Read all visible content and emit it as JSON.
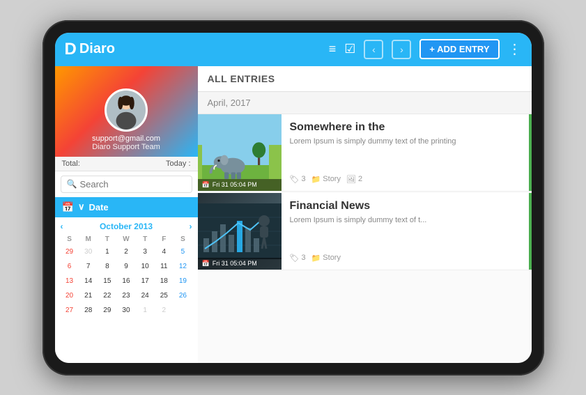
{
  "app": {
    "name": "Diaro",
    "logo_letter": "D"
  },
  "toolbar": {
    "add_entry_label": "+ ADD ENTRY",
    "nav_back": "‹",
    "nav_forward": "›"
  },
  "sidebar": {
    "email": "support@gmail.com",
    "team": "Diaro Support Team",
    "stats": {
      "total_label": "Total:",
      "today_label": "Today :"
    },
    "search_placeholder": "Search",
    "date_filter_label": "Date"
  },
  "calendar": {
    "month": "October 2013",
    "day_headers": [
      "S",
      "M",
      "T",
      "W",
      "T",
      "F",
      "S"
    ],
    "today_day": 1,
    "weeks": [
      [
        "29",
        "30",
        "1",
        "2",
        "3",
        "4",
        "5"
      ],
      [
        "6",
        "7",
        "8",
        "9",
        "10",
        "11",
        "12"
      ],
      [
        "13",
        "14",
        "15",
        "16",
        "17",
        "18",
        "19"
      ],
      [
        "20",
        "21",
        "22",
        "23",
        "24",
        "25",
        "26"
      ],
      [
        "27",
        "28",
        "29",
        "30",
        "1",
        "2",
        ""
      ]
    ]
  },
  "entries": {
    "header": "ALL ENTRIES",
    "section_date": "April, 2017",
    "items": [
      {
        "title": "Somewhere in the",
        "excerpt": "Lorem Ipsum is simply dummy text of the printing",
        "date": "Fri 31  05:04 PM",
        "tags_count": 3,
        "category": "Story",
        "images_count": 2
      },
      {
        "title": "Financial News",
        "excerpt": "Lorem Ipsum is simply dummy text of t...",
        "date": "Fri 31  05:04 PM",
        "tags_count": 3,
        "category": "Story",
        "images_count": ""
      }
    ]
  }
}
